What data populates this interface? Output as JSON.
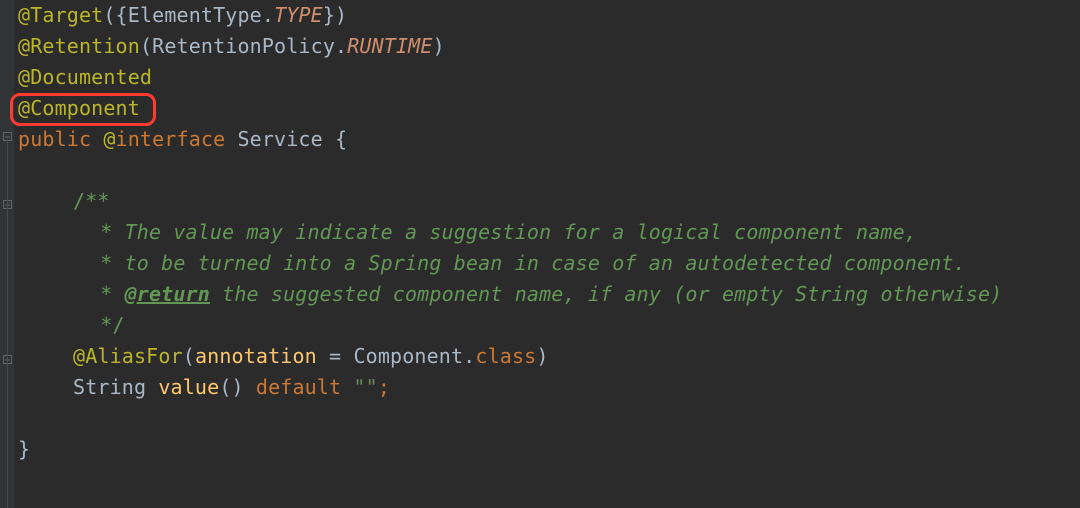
{
  "line1": {
    "at": "@",
    "target": "Target",
    "lp": "({",
    "elemtype": "ElementType",
    "dot": ".",
    "type": "TYPE",
    "rp": "})"
  },
  "line2": {
    "at": "@",
    "retention": "Retention",
    "lp": "(",
    "retpol": "RetentionPolicy",
    "dot": ".",
    "runtime": "RUNTIME",
    "rp": ")"
  },
  "line3": {
    "at": "@",
    "documented": "Documented"
  },
  "line4": {
    "at": "@",
    "component": "Component"
  },
  "line5": {
    "pub": "public ",
    "at": "@",
    "intf": "interface ",
    "service": "Service ",
    "brace": "{"
  },
  "doc": {
    "open": "/**",
    "star": " *",
    "l1": " The value may indicate a suggestion for a logical component name,",
    "l2": " to be turned into a Spring bean in case of an autodetected component.",
    "tag": "@return",
    "l3": " the suggested component name, if any (or empty String otherwise)",
    "close": " */"
  },
  "line11": {
    "at": "@",
    "alias": "AliasFor",
    "lp": "(",
    "param": "annotation",
    "eq": " = ",
    "comp": "Component",
    "dot": ".",
    "klass": "class",
    "rp": ")"
  },
  "line12": {
    "str": "String ",
    "value": "value",
    "paren": "() ",
    "def": "default ",
    "lit": "\"\"",
    "semi": ";"
  },
  "close": "}"
}
